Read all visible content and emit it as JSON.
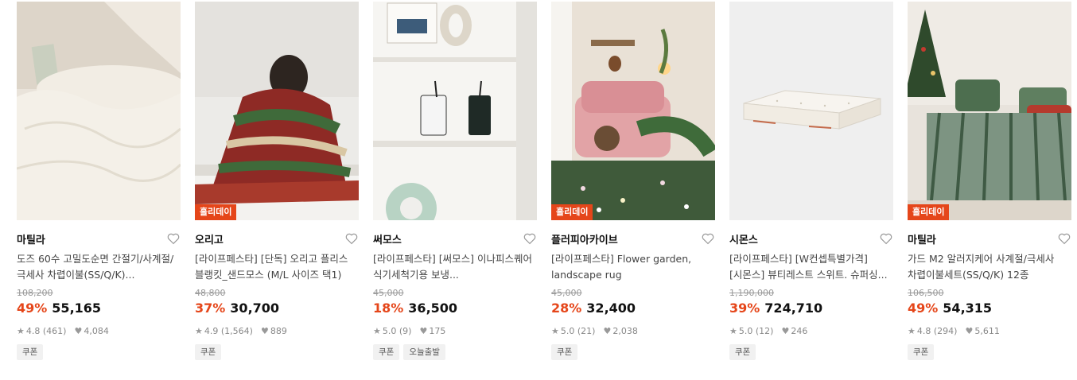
{
  "colors": {
    "accent": "#e5461a",
    "price": "#111111",
    "tag_bg": "#f1f1f1"
  },
  "products": [
    {
      "badge": "",
      "brand": "마틸라",
      "title": "도즈 60수 고밀도순면 간절기/사계절/극세사 차렵이불(SS/Q/K)...",
      "original_price": "108,200",
      "discount": "49%",
      "price": "55,165",
      "rating": "4.8",
      "reviews": "(461)",
      "likes": "4,084",
      "tags": [
        "쿠폰"
      ],
      "image": "white-duvet-bedding"
    },
    {
      "badge": "홀리데이",
      "brand": "오리고",
      "title": "[라이프페스타] [단독] 오리고 플리스 블랭킷_샌드모스 (M/L 사이즈 택1)",
      "original_price": "48,800",
      "discount": "37%",
      "price": "30,700",
      "rating": "4.9",
      "reviews": "(1,564)",
      "likes": "889",
      "tags": [
        "쿠폰"
      ],
      "image": "woman-striped-blanket"
    },
    {
      "badge": "",
      "brand": "써모스",
      "title": "[라이프페스타] [써모스] 이나피스퀘어 식기세척기용 보냉...",
      "original_price": "45,000",
      "discount": "18%",
      "price": "36,500",
      "rating": "5.0",
      "reviews": "(9)",
      "likes": "175",
      "tags": [
        "쿠폰",
        "오늘출발"
      ],
      "image": "mugs-on-shelf"
    },
    {
      "badge": "홀리데이",
      "brand": "플러피아카이브",
      "title": "[라이프페스타] Flower garden, landscape rug",
      "original_price": "45,000",
      "discount": "28%",
      "price": "32,400",
      "rating": "5.0",
      "reviews": "(21)",
      "likes": "2,038",
      "tags": [
        "쿠폰"
      ],
      "image": "pink-sofa-garden-rug"
    },
    {
      "badge": "",
      "brand": "시몬스",
      "title": "[라이프페스타] [W컨셉특별가격] [시몬스] 뷰티레스트 스위트. 슈퍼싱...",
      "original_price": "1,190,000",
      "discount": "39%",
      "price": "724,710",
      "rating": "5.0",
      "reviews": "(12)",
      "likes": "246",
      "tags": [
        "쿠폰"
      ],
      "image": "mattress"
    },
    {
      "badge": "홀리데이",
      "brand": "마틸라",
      "title": "가드 M2 알러지케어 사계절/극세사 차렵이불세트(SS/Q/K) 12종",
      "original_price": "106,500",
      "discount": "49%",
      "price": "54,315",
      "rating": "4.8",
      "reviews": "(294)",
      "likes": "5,611",
      "tags": [
        "쿠폰"
      ],
      "image": "green-striped-bedding"
    }
  ]
}
